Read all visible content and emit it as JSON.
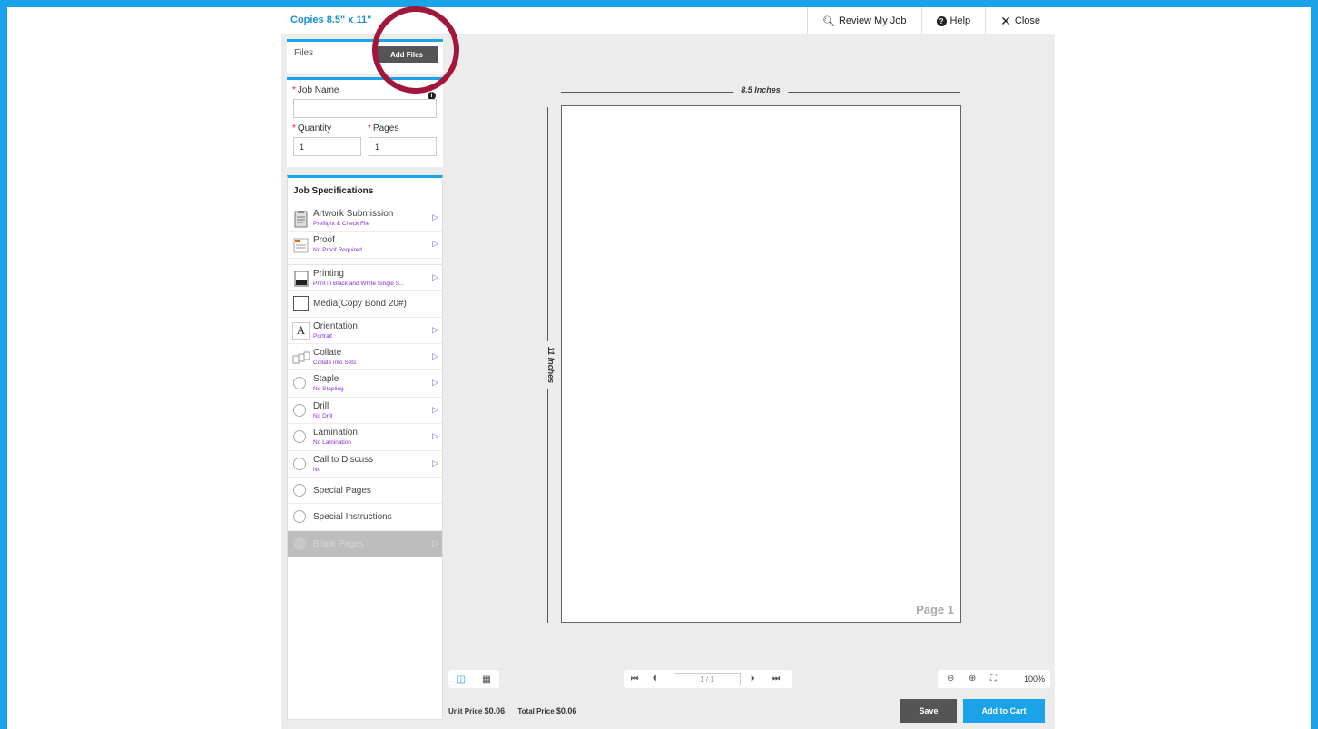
{
  "app": {
    "title": "Copies 8.5\" x 11\""
  },
  "topbar": {
    "review_label": "Review My Job",
    "help_label": "Help",
    "close_label": "Close"
  },
  "files": {
    "label": "Files",
    "add_button": "Add Files"
  },
  "job": {
    "name_label": "Job Name",
    "name_value": "",
    "quantity_label": "Quantity",
    "quantity_value": "1",
    "pages_label": "Pages",
    "pages_value": "1"
  },
  "specs": {
    "title": "Job Specifications",
    "items": [
      {
        "name": "Artwork Submission",
        "sub": "Preflight & Check File"
      },
      {
        "name": "Proof",
        "sub": "No Proof Required"
      },
      {
        "name": "Printing",
        "sub": "Print in Black and White Single S..."
      },
      {
        "name": "Media(Copy Bond 20#)",
        "sub": ""
      },
      {
        "name": "Orientation",
        "sub": "Portrait"
      },
      {
        "name": "Collate",
        "sub": "Collate into Sets"
      },
      {
        "name": "Staple",
        "sub": "No Stapling"
      },
      {
        "name": "Drill",
        "sub": "No Drill"
      },
      {
        "name": "Lamination",
        "sub": "No Lamination"
      },
      {
        "name": "Call to Discuss",
        "sub": "No"
      },
      {
        "name": "Special Pages",
        "sub": ""
      },
      {
        "name": "Special Instructions",
        "sub": ""
      },
      {
        "name": "Blank Pages",
        "sub": ""
      }
    ]
  },
  "preview": {
    "width_label": "8.5 Inches",
    "height_label": "11 Inches",
    "page_label": "Page 1"
  },
  "pager": {
    "value": "1 / 1"
  },
  "zoom": {
    "level": "100%"
  },
  "pricing": {
    "unit_label": "Unit Price",
    "unit_value": "$0.06",
    "total_label": "Total Price",
    "total_value": "$0.06"
  },
  "actions": {
    "save": "Save",
    "add_to_cart": "Add to Cart"
  },
  "colors": {
    "accent": "#1aa3e8",
    "highlight_ring": "#a31637",
    "sub_text": "#8a2be2",
    "dark_button": "#555555"
  }
}
